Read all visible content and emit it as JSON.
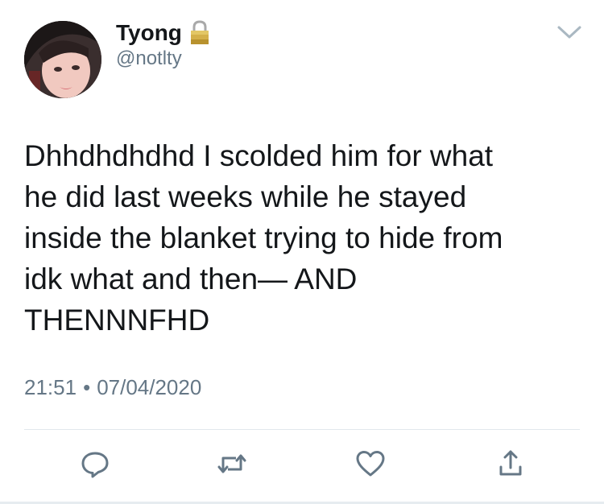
{
  "user": {
    "display_name": "Tyong",
    "handle": "@notlty",
    "lock_icon": "lock-icon",
    "avatar": "avatar"
  },
  "tweet": {
    "text": "Dhhdhdhdhd I scolded him for what\nhe did last weeks while he stayed\ninside the blanket trying to hide from\nidk what and then— AND\nTHENNNFHD",
    "time": "21:51",
    "separator": "•",
    "date": "07/04/2020"
  },
  "actions": {
    "reply_icon": "reply-icon",
    "retweet_icon": "retweet-icon",
    "like_icon": "heart-icon",
    "share_icon": "share-icon"
  },
  "colors": {
    "text": "#14171a",
    "secondary": "#657786",
    "icon": "#657786",
    "divider": "#e1e8ed"
  }
}
